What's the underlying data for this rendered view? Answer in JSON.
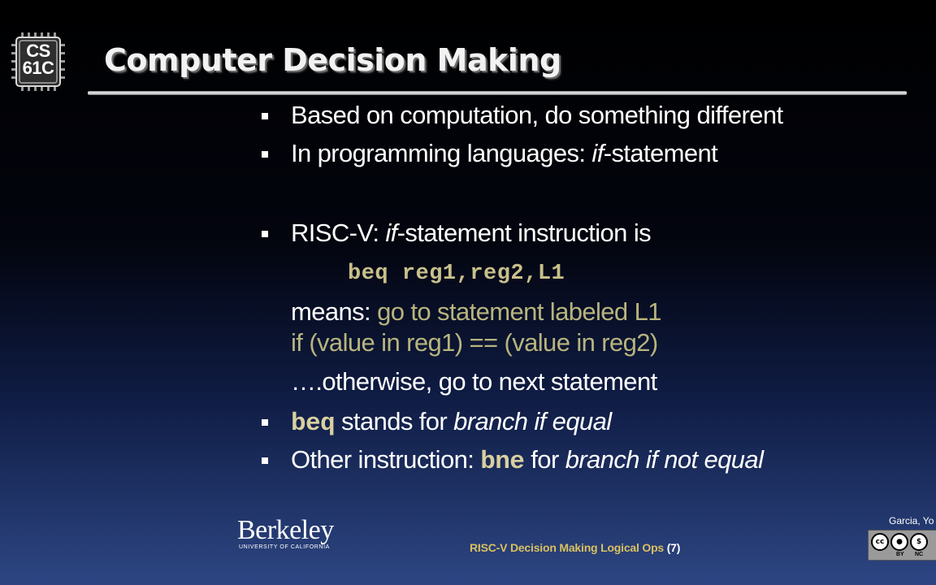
{
  "logo": {
    "line1": "CS",
    "line2": "61C"
  },
  "title": "Computer Decision Making",
  "bullets": {
    "b1": "Based on computation, do something different",
    "b2_prefix": "In programming languages: ",
    "b2_em": "if",
    "b2_suffix": "-statement",
    "b3_prefix": "RISC-V: ",
    "b3_em": "if",
    "b3_suffix": "-statement instruction is",
    "instruction": "beq reg1,reg2,L1",
    "means_label": "means",
    "means_colon": ": ",
    "means_text": "go to statement labeled L1",
    "condition": "if (value in reg1) == (value in reg2)",
    "otherwise": "….otherwise, go to next statement",
    "b4_code": "beq",
    "b4_text": " stands for ",
    "b4_em": "branch if equal",
    "b5_prefix": "Other instruction: ",
    "b5_code": "bne",
    "b5_text": " for ",
    "b5_em": "branch if not equal"
  },
  "berkeley": {
    "word": "Berkeley",
    "sub": "UNIVERSITY OF CALIFORNIA"
  },
  "footer": {
    "label": "RISC-V Decision Making Logical Ops ",
    "page": "(7)"
  },
  "author": "Garcia, Yo",
  "license": {
    "by": "BY",
    "nc": "NC"
  },
  "colors": {
    "background_top": "#000000",
    "background_bottom": "#2d4683",
    "code_text": "#c8c08a",
    "footer_text": "#d9c060"
  }
}
